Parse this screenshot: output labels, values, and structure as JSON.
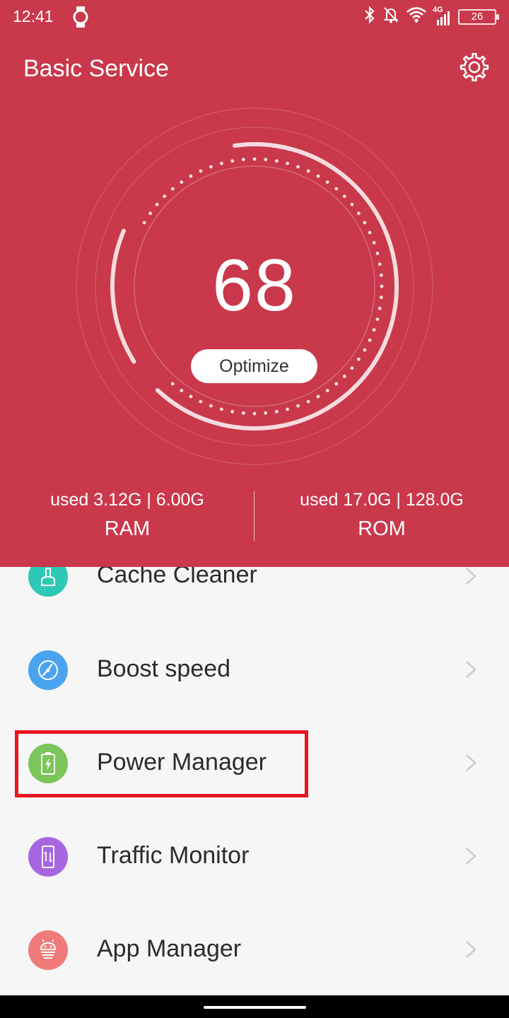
{
  "status_bar": {
    "time": "12:41",
    "network": "4G",
    "battery": "26",
    "icons": [
      "watch-icon",
      "bluetooth-icon",
      "notifications-off-icon",
      "wifi-icon",
      "signal-icon",
      "battery-icon"
    ]
  },
  "header": {
    "title": "Basic Service",
    "settings_icon": "gear-icon",
    "background_color": "#c9384b"
  },
  "gauge": {
    "score": "68",
    "optimize_label": "Optimize"
  },
  "stats": {
    "ram": {
      "used": "used 3.12G | 6.00G",
      "label": "RAM"
    },
    "rom": {
      "used": "used 17.0G | 128.0G",
      "label": "ROM"
    }
  },
  "menu": {
    "items": [
      {
        "label": "Cache Cleaner",
        "icon": "broom-icon",
        "color": "#2ec9b4"
      },
      {
        "label": "Boost speed",
        "icon": "speedometer-icon",
        "color": "#4aa3ee"
      },
      {
        "label": "Power Manager",
        "icon": "battery-bolt-icon",
        "color": "#7cc55a"
      },
      {
        "label": "Traffic Monitor",
        "icon": "phone-traffic-icon",
        "color": "#a865e0"
      },
      {
        "label": "App Manager",
        "icon": "android-icon",
        "color": "#f07a7a"
      }
    ],
    "chevron_icon": "chevron-right-icon",
    "highlight_color": "#e8141e"
  }
}
